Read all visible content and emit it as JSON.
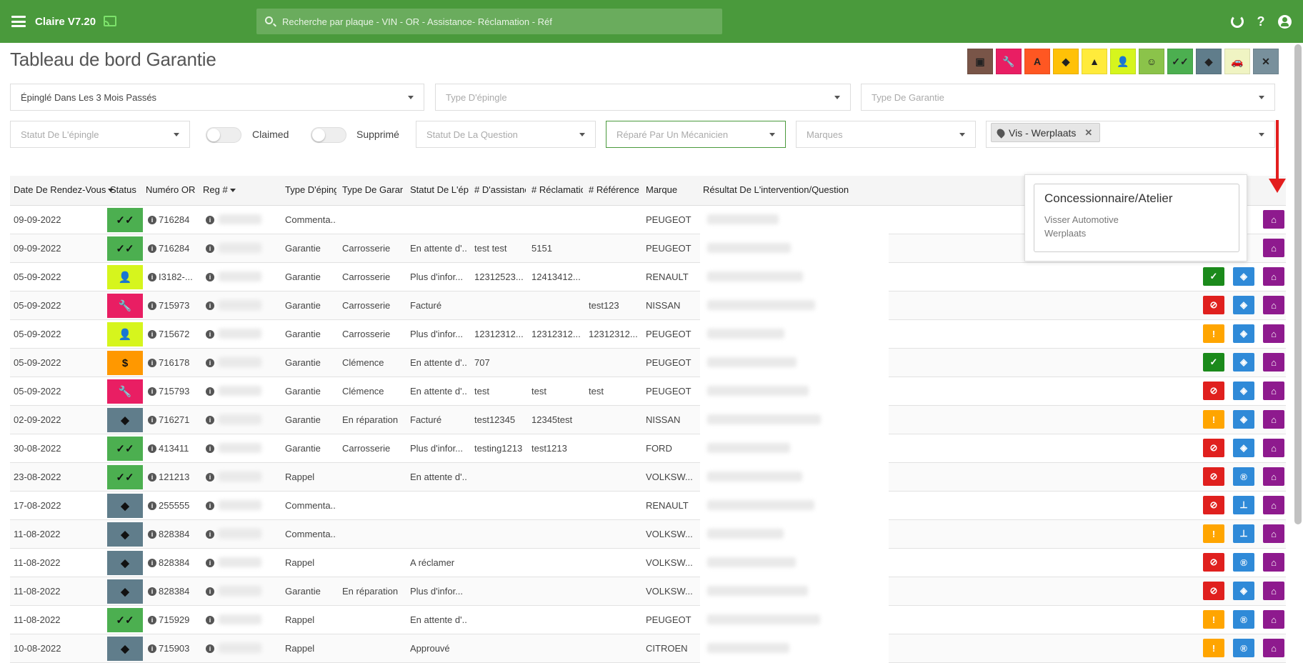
{
  "app": {
    "title": "Claire V7.20"
  },
  "search": {
    "placeholder": "Recherche par plaque - VIN - OR - Assistance- Réclamation - Réf"
  },
  "page": {
    "title": "Tableau de bord Garantie"
  },
  "palette": [
    {
      "icon": "calendar-icon",
      "color": "#795548",
      "glyph": "▣"
    },
    {
      "icon": "wrench-icon",
      "color": "#e91e63",
      "glyph": "🔧"
    },
    {
      "icon": "font-a-icon",
      "color": "#ff5722",
      "glyph": "A"
    },
    {
      "icon": "tag-icon",
      "color": "#ffc107",
      "glyph": "◆"
    },
    {
      "icon": "warning-icon",
      "color": "#ffeb3b",
      "glyph": "▲"
    },
    {
      "icon": "user-check-icon",
      "color": "#d6f51d",
      "glyph": "👤"
    },
    {
      "icon": "smile-icon",
      "color": "#8bc34a",
      "glyph": "☺"
    },
    {
      "icon": "double-check-icon",
      "color": "#4caf50",
      "glyph": "✓✓"
    },
    {
      "icon": "shield-icon",
      "color": "#607d8b",
      "glyph": "◆"
    },
    {
      "icon": "car-icon",
      "color": "#f0f4c3",
      "glyph": "🚗"
    },
    {
      "icon": "close-circle-icon",
      "color": "#78909c",
      "glyph": "✕"
    }
  ],
  "filters": {
    "pinned_period": "Épinglé Dans Les 3 Mois Passés",
    "pin_type": "Type D'épingle",
    "warranty_type": "Type De Garantie",
    "pin_status": "Statut De L'épingle",
    "claimed_label": "Claimed",
    "deleted_label": "Supprimé",
    "question_status": "Statut De La Question",
    "repaired_by": "Réparé Par Un Mécanicien",
    "brands": "Marques",
    "location_chip": "Vis - Werplaats"
  },
  "columns": {
    "date": "Date De Rendez-Vous",
    "status": "Status",
    "or_number": "Numéro OR",
    "reg": "Reg #",
    "pin_type": "Type D'épingle",
    "warranty_type": "Type De Garantie",
    "pin_status": "Statut De L'épingle",
    "assistance": "# D'assistance",
    "claim": "# Réclamation",
    "reference": "# Référence",
    "brand": "Marque",
    "result": "Résultat De L'intervention/Question"
  },
  "rows": [
    {
      "date": "09-09-2022",
      "status": "double-check",
      "or": "716284",
      "type": "Commenta...",
      "wtype": "",
      "pstatus": "",
      "assist": "",
      "claim": "",
      "ref": "",
      "brand": "PEUGEOT",
      "actions": [
        "home"
      ]
    },
    {
      "date": "09-09-2022",
      "status": "double-check",
      "or": "716284",
      "type": "Garantie",
      "wtype": "Carrosserie",
      "pstatus": "En attente d'...",
      "assist": "test test",
      "claim": "5151",
      "ref": "",
      "brand": "PEUGEOT",
      "actions": [
        "home"
      ]
    },
    {
      "date": "05-09-2022",
      "status": "user-check",
      "or": "I3182-...",
      "type": "Garantie",
      "wtype": "Carrosserie",
      "pstatus": "Plus d'infor...",
      "assist": "12312523...",
      "claim": "12413412...",
      "ref": "",
      "brand": "RENAULT",
      "actions": [
        "check",
        "shield",
        "home"
      ]
    },
    {
      "date": "05-09-2022",
      "status": "wrench",
      "or": "715973",
      "type": "Garantie",
      "wtype": "Carrosserie",
      "pstatus": "Facturé",
      "assist": "",
      "claim": "",
      "ref": "test123",
      "brand": "NISSAN",
      "actions": [
        "ban",
        "shield",
        "home"
      ]
    },
    {
      "date": "05-09-2022",
      "status": "user-check",
      "or": "715672",
      "type": "Garantie",
      "wtype": "Carrosserie",
      "pstatus": "Plus d'infor...",
      "assist": "12312312...",
      "claim": "12312312...",
      "ref": "12312312...",
      "brand": "PEUGEOT",
      "actions": [
        "alert",
        "shield",
        "home"
      ]
    },
    {
      "date": "05-09-2022",
      "status": "dollar",
      "or": "716178",
      "type": "Garantie",
      "wtype": "Clémence",
      "pstatus": "En attente d'...",
      "assist": "707",
      "claim": "",
      "ref": "",
      "brand": "PEUGEOT",
      "actions": [
        "check",
        "shield",
        "home"
      ]
    },
    {
      "date": "05-09-2022",
      "status": "wrench",
      "or": "715793",
      "type": "Garantie",
      "wtype": "Clémence",
      "pstatus": "En attente d'...",
      "assist": "test",
      "claim": "test",
      "ref": "test",
      "brand": "PEUGEOT",
      "actions": [
        "ban",
        "shield",
        "home"
      ]
    },
    {
      "date": "02-09-2022",
      "status": "shield",
      "or": "716271",
      "type": "Garantie",
      "wtype": "En réparation",
      "pstatus": "Facturé",
      "assist": "test12345",
      "claim": "12345test",
      "ref": "",
      "brand": "NISSAN",
      "actions": [
        "alert",
        "shield",
        "home"
      ]
    },
    {
      "date": "30-08-2022",
      "status": "double-check",
      "or": "413411",
      "type": "Garantie",
      "wtype": "Carrosserie",
      "pstatus": "Plus d'infor...",
      "assist": "testing1213",
      "claim": "test1213",
      "ref": "",
      "brand": "FORD",
      "actions": [
        "ban",
        "shield",
        "home"
      ]
    },
    {
      "date": "23-08-2022",
      "status": "double-check",
      "or": "121213",
      "type": "Rappel",
      "wtype": "",
      "pstatus": "En attente d'...",
      "assist": "",
      "claim": "",
      "ref": "",
      "brand": "VOLKSW...",
      "actions": [
        "ban",
        "registered",
        "home"
      ]
    },
    {
      "date": "17-08-2022",
      "status": "shield",
      "or": "255555",
      "type": "Commenta...",
      "wtype": "",
      "pstatus": "",
      "assist": "",
      "claim": "",
      "ref": "",
      "brand": "RENAULT",
      "actions": [
        "ban",
        "pin",
        "home"
      ]
    },
    {
      "date": "11-08-2022",
      "status": "shield",
      "or": "828384",
      "type": "Commenta...",
      "wtype": "",
      "pstatus": "",
      "assist": "",
      "claim": "",
      "ref": "",
      "brand": "VOLKSW...",
      "actions": [
        "alert",
        "pin",
        "home"
      ]
    },
    {
      "date": "11-08-2022",
      "status": "shield",
      "or": "828384",
      "type": "Rappel",
      "wtype": "",
      "pstatus": "A réclamer",
      "assist": "",
      "claim": "",
      "ref": "",
      "brand": "VOLKSW...",
      "actions": [
        "ban",
        "registered",
        "home"
      ]
    },
    {
      "date": "11-08-2022",
      "status": "shield",
      "or": "828384",
      "type": "Garantie",
      "wtype": "En réparation",
      "pstatus": "Plus d'infor...",
      "assist": "",
      "claim": "",
      "ref": "",
      "brand": "VOLKSW...",
      "actions": [
        "ban",
        "shield",
        "home"
      ]
    },
    {
      "date": "11-08-2022",
      "status": "double-check",
      "or": "715929",
      "type": "Rappel",
      "wtype": "",
      "pstatus": "En attente d'...",
      "assist": "",
      "claim": "",
      "ref": "",
      "brand": "PEUGEOT",
      "actions": [
        "alert",
        "registered",
        "home"
      ]
    },
    {
      "date": "10-08-2022",
      "status": "shield",
      "or": "715903",
      "type": "Rappel",
      "wtype": "",
      "pstatus": "Approuvé",
      "assist": "",
      "claim": "",
      "ref": "",
      "brand": "CITROEN",
      "actions": [
        "alert",
        "registered",
        "home"
      ]
    }
  ],
  "popover": {
    "title": "Concessionnaire/Atelier",
    "line1": "Visser Automotive",
    "line2": "Werplaats"
  }
}
